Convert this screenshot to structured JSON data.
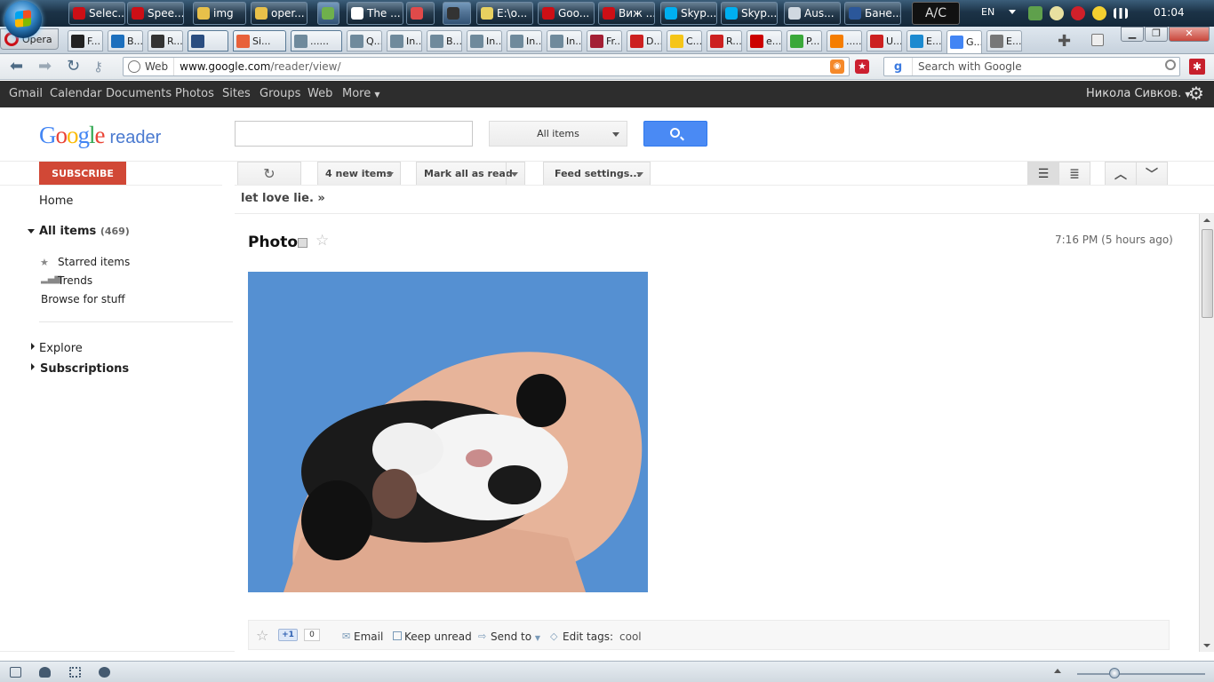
{
  "taskbar": {
    "items": [
      {
        "label": "Selec...",
        "color": "#cc0f16"
      },
      {
        "label": "Spee...",
        "color": "#cc0f16"
      },
      {
        "label": "img",
        "color": "#e8c04a"
      },
      {
        "label": "oper...",
        "color": "#e8c04a"
      },
      {
        "label": "",
        "color": "#6fb04c"
      },
      {
        "label": "The ...",
        "color": "#ffffff"
      },
      {
        "label": "",
        "color": "#e04a4a"
      },
      {
        "label": "",
        "color": "#333333"
      },
      {
        "label": "E:\\o...",
        "color": "#e8d060"
      },
      {
        "label": "Goo...",
        "color": "#cc0f16"
      },
      {
        "label": "Виж ...",
        "color": "#cc0f16"
      },
      {
        "label": "Skyp...",
        "color": "#00aff0"
      },
      {
        "label": "Skyp...",
        "color": "#00aff0"
      },
      {
        "label": "Aus...",
        "color": "#d0d8e0"
      },
      {
        "label": "Бане...",
        "color": "#2b579a"
      }
    ],
    "ac_label": "A/C",
    "language": "EN",
    "clock": "01:04"
  },
  "browser": {
    "opera_label": "Opera",
    "tabs": [
      {
        "label": "F...",
        "color": "#222222"
      },
      {
        "label": "B...",
        "color": "#1c6fbd"
      },
      {
        "label": "R...",
        "color": "#333333"
      },
      {
        "label": "",
        "color": "#2a4d80"
      },
      {
        "label": "Si...",
        "color": "#e8613a"
      },
      {
        "label": "......",
        "color": "#6f8a9c"
      },
      {
        "label": "Q...",
        "color": "#6f8a9c"
      },
      {
        "label": "In...",
        "color": "#6f8a9c"
      },
      {
        "label": "B...",
        "color": "#6f8a9c"
      },
      {
        "label": "In...",
        "color": "#6f8a9c"
      },
      {
        "label": "In...",
        "color": "#6f8a9c"
      },
      {
        "label": "In...",
        "color": "#6f8a9c"
      },
      {
        "label": "Fr...",
        "color": "#a31f34"
      },
      {
        "label": "D...",
        "color": "#cc2020"
      },
      {
        "label": "C...",
        "color": "#f5c518"
      },
      {
        "label": "R...",
        "color": "#cc2020"
      },
      {
        "label": "e...",
        "color": "#cc0000"
      },
      {
        "label": "P...",
        "color": "#3aa83a"
      },
      {
        "label": "......",
        "color": "#f57d00"
      },
      {
        "label": "U...",
        "color": "#cc2020"
      },
      {
        "label": "E...",
        "color": "#1c8ad0"
      },
      {
        "label": "G...",
        "color": "#4285f4"
      },
      {
        "label": "E...",
        "color": "#777777"
      }
    ],
    "address_scope": "Web",
    "url_domain": "www.google.com",
    "url_path": "/reader/view/",
    "search_placeholder": "Search with Google"
  },
  "gbar": {
    "links": [
      "Gmail",
      "Calendar",
      "Documents",
      "Photos",
      "Sites",
      "Groups",
      "Web",
      "More"
    ],
    "user": "Никола Сивков."
  },
  "reader": {
    "logo_brand": "Google",
    "logo_product": "reader",
    "search_scope": "All items",
    "subscribe_label": "SUBSCRIBE",
    "nav": {
      "home": "Home",
      "all_items": "All items",
      "all_items_count": "(469)",
      "starred": "Starred items",
      "trends": "Trends",
      "browse": "Browse for stuff",
      "explore": "Explore",
      "subscriptions": "Subscriptions"
    },
    "toolbar": {
      "new_items": "4 new items",
      "mark_all_read": "Mark all as read",
      "feed_settings": "Feed settings..."
    },
    "feed_title": "let love lie. »",
    "entry": {
      "title": "Photo",
      "time": "7:16 PM (5 hours ago)",
      "plusone_label": "+1",
      "plusone_count": "0",
      "email": "Email",
      "keep_unread": "Keep unread",
      "send_to": "Send to",
      "edit_tags": "Edit tags:",
      "tags": "cool"
    }
  }
}
